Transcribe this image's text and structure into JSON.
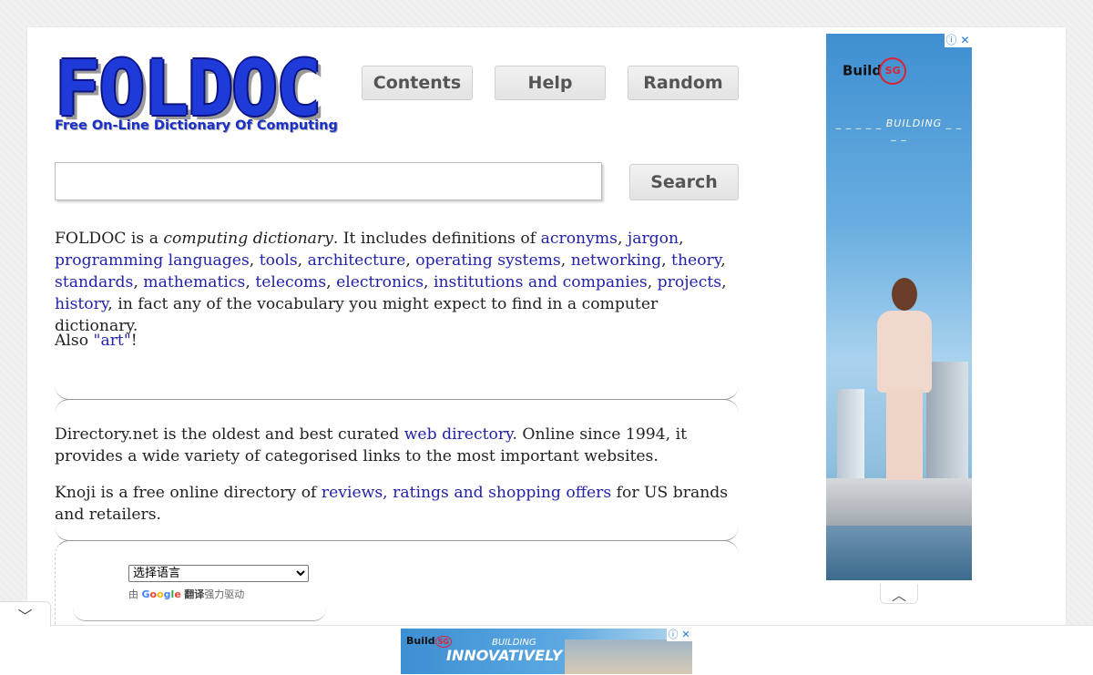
{
  "logo": {
    "word": "FOLDOC",
    "tagline": "Free On-Line Dictionary Of Computing"
  },
  "nav": {
    "contents": "Contents",
    "help": "Help",
    "random": "Random"
  },
  "search": {
    "value": "",
    "button": "Search"
  },
  "intro": {
    "t1": "FOLDOC is a ",
    "em": "computing dictionary",
    "t2": ". It includes definitions of ",
    "links": [
      "acronyms",
      "jargon",
      "programming languages",
      "tools",
      "architecture",
      "operating systems",
      "networking",
      "theory",
      "standards",
      "mathematics",
      "telecoms",
      "electronics",
      "institutions and companies",
      "projects",
      "history"
    ],
    "tail": ", in fact any of the vocabulary you might expect to find in a computer dictionary."
  },
  "also": {
    "prefix": "Also ",
    "link": "\"art\"",
    "suffix": "!"
  },
  "directory": {
    "t1": "Directory.net is the oldest and best curated ",
    "link": "web directory",
    "t2": ". Online since 1994, it provides a wide variety of categorised links to the most important websites."
  },
  "knoji": {
    "t1": "Knoji is a free online directory of ",
    "link": "reviews, ratings and shopping offers",
    "t2": " for US brands and retailers."
  },
  "translate": {
    "select_value": "选择语言",
    "powered_prefix": "由 ",
    "google": "Google",
    "fanyi": "翻译",
    "powered_suffix": "强力驱动"
  },
  "side_ad": {
    "brand": "Build",
    "brand_badge": "SG",
    "headline": "_ _ _ _ _ BUILDING _ _ _ _",
    "info_icon": "ⓘ",
    "close_icon": "✕"
  },
  "bottom_ad": {
    "brand": "Build",
    "badge": "SG",
    "line1": "BUILDING",
    "line2": "INNOVATIVELY",
    "info_icon": "ⓘ",
    "close_icon": "✕"
  },
  "icons": {
    "chevron_up": "chevron-up-icon",
    "chevron_down": "chevron-down-icon"
  },
  "colors": {
    "link": "#2222aa",
    "logo_blue": "#1e3ad8"
  }
}
